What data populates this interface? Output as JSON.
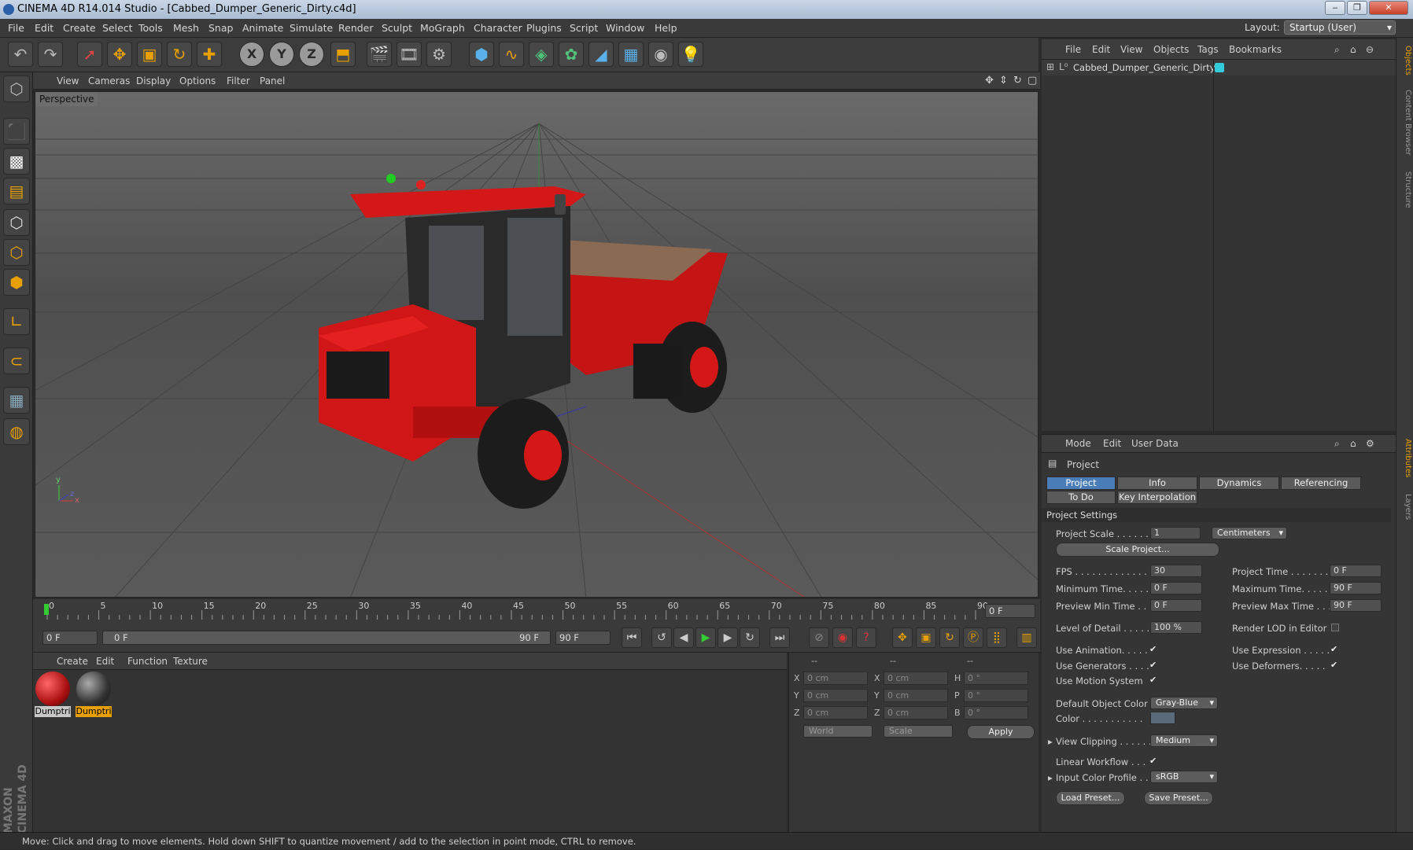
{
  "window": {
    "title": "CINEMA 4D R14.014 Studio - [Cabbed_Dumper_Generic_Dirty.c4d]",
    "minimize": "‒",
    "maximize": "❐",
    "close": "✕"
  },
  "menu": [
    "File",
    "Edit",
    "Create",
    "Select",
    "Tools",
    "Mesh",
    "Snap",
    "Animate",
    "Simulate",
    "Render",
    "Sculpt",
    "MoGraph",
    "Character",
    "Plugins",
    "Script",
    "Window",
    "Help"
  ],
  "layout": {
    "label": "Layout:",
    "value": "Startup (User)"
  },
  "viewport": {
    "menu": [
      "View",
      "Cameras",
      "Display",
      "Options",
      "Filter",
      "Panel"
    ],
    "label": "Perspective",
    "axis_y": "y",
    "axis_z": "z",
    "axis_x": "x"
  },
  "timeline": {
    "ticks": [
      "0",
      "5",
      "10",
      "15",
      "20",
      "25",
      "30",
      "35",
      "40",
      "45",
      "50",
      "55",
      "60",
      "65",
      "70",
      "75",
      "80",
      "85",
      "90"
    ],
    "current": "0 F",
    "start_field": "0 F",
    "range_start": "0 F",
    "range_end": "90 F",
    "end_field": "90 F"
  },
  "materials": {
    "menu": [
      "Create",
      "Edit",
      "Function",
      "Texture"
    ],
    "items": [
      {
        "name": "Dumptri"
      },
      {
        "name": "Dumptri"
      }
    ]
  },
  "coordinates": {
    "header": [
      "--",
      "--",
      "--"
    ],
    "rows": [
      {
        "a": "X",
        "av": "0 cm",
        "b": "X",
        "bv": "0 cm",
        "c": "H",
        "cv": "0 °"
      },
      {
        "a": "Y",
        "av": "0 cm",
        "b": "Y",
        "bv": "0 cm",
        "c": "P",
        "cv": "0 °"
      },
      {
        "a": "Z",
        "av": "0 cm",
        "b": "Z",
        "bv": "0 cm",
        "c": "B",
        "cv": "0 °"
      }
    ],
    "world": "World",
    "scale": "Scale",
    "apply": "Apply"
  },
  "objects": {
    "menu": [
      "File",
      "Edit",
      "View",
      "Objects",
      "Tags",
      "Bookmarks"
    ],
    "items": [
      {
        "name": "Cabbed_Dumper_Generic_Dirty"
      }
    ]
  },
  "side_tabs": [
    "Objects",
    "Content Browser",
    "Structure",
    "Attributes",
    "Layers"
  ],
  "attributes": {
    "menu": [
      "Mode",
      "Edit",
      "User Data"
    ],
    "title": "Project",
    "tabs": [
      "Project Settings",
      "Info",
      "Dynamics",
      "Referencing",
      "To Do",
      "Key Interpolation"
    ],
    "section": "Project Settings",
    "project_scale_label": "Project Scale . . . . . .",
    "project_scale_value": "1",
    "units": "Centimeters",
    "scale_project": "Scale Project...",
    "fps_label": "FPS . . . . . . . . . . . . . . .",
    "fps": "30",
    "project_time_label": "Project Time . . . . . . .",
    "project_time": "0 F",
    "min_time_label": "Minimum Time. . . . . . .",
    "min_time": "0 F",
    "max_time_label": "Maximum Time. . . . . .",
    "max_time": "90 F",
    "prev_min_label": "Preview Min Time . .",
    "prev_min": "0 F",
    "prev_max_label": "Preview Max Time . . .",
    "prev_max": "90 F",
    "lod_label": "Level of Detail . . . . .",
    "lod": "100 %",
    "render_lod_label": "Render LOD in Editor",
    "use_animation": "Use Animation. . . . .",
    "use_expression": "Use Expression . . . . .",
    "use_generators": "Use Generators . . . .",
    "use_deformers": "Use Deformers. . . . .",
    "use_motion": "Use Motion System",
    "default_color_label": "Default Object Color",
    "default_color": "Gray-Blue",
    "color_label": "Color . . . . . . . . . . .",
    "view_clipping_label": "View Clipping . . . . . .",
    "view_clipping": "Medium",
    "linear_workflow": "Linear Workflow . . .",
    "input_profile_label": "Input Color Profile . .",
    "input_profile": "sRGB",
    "load_preset": "Load Preset...",
    "save_preset": "Save Preset...",
    "check": "✔"
  },
  "status": "Move: Click and drag to move elements. Hold down SHIFT to quantize movement / add to the selection in point mode, CTRL to remove.",
  "colors": {
    "accent": "#4a7cb8",
    "truck_red": "#d81818",
    "bg": "#2b2b2b"
  },
  "icons": {
    "main_tools": [
      "undo-icon",
      "redo-icon",
      "live-select-icon",
      "move-icon",
      "scale-icon",
      "rotate-icon",
      "add-icon",
      "x-axis-icon",
      "y-axis-icon",
      "z-axis-icon",
      "coordinate-system-icon",
      "render-view-icon",
      "render-picture-viewer-icon",
      "edit-render-settings-icon",
      "cube-icon",
      "spline-icon",
      "nurbs-icon",
      "array-icon",
      "deformer-icon",
      "floor-icon",
      "camera-icon",
      "light-icon"
    ]
  }
}
